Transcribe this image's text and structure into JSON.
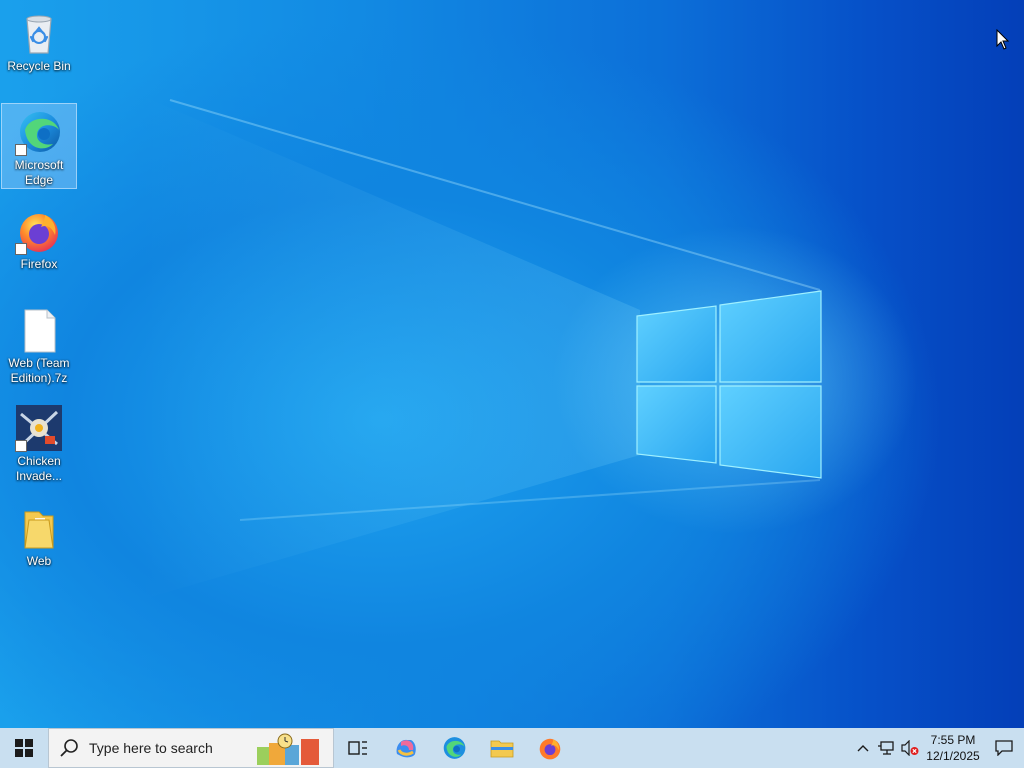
{
  "desktop": {
    "icons": [
      {
        "label": "Recycle Bin",
        "icon": "recycle-bin-icon"
      },
      {
        "label": "Microsoft Edge",
        "icon": "edge-icon",
        "selected": true
      },
      {
        "label": "Firefox",
        "icon": "firefox-icon"
      },
      {
        "label": "Web (Team Edition).7z",
        "icon": "archive-file-icon"
      },
      {
        "label": "Chicken Invade...",
        "icon": "chicken-invaders-icon"
      },
      {
        "label": "Web",
        "icon": "folder-icon"
      }
    ]
  },
  "taskbar": {
    "search_placeholder": "Type here to search",
    "apps": [
      "task-view-icon",
      "copilot-icon",
      "edge-icon",
      "file-explorer-icon",
      "firefox-icon"
    ],
    "clock": {
      "time": "7:55 PM",
      "date": "12/1/2025"
    },
    "colors": {
      "taskbar": "#c9dff0",
      "accent": "#0078d4"
    }
  }
}
